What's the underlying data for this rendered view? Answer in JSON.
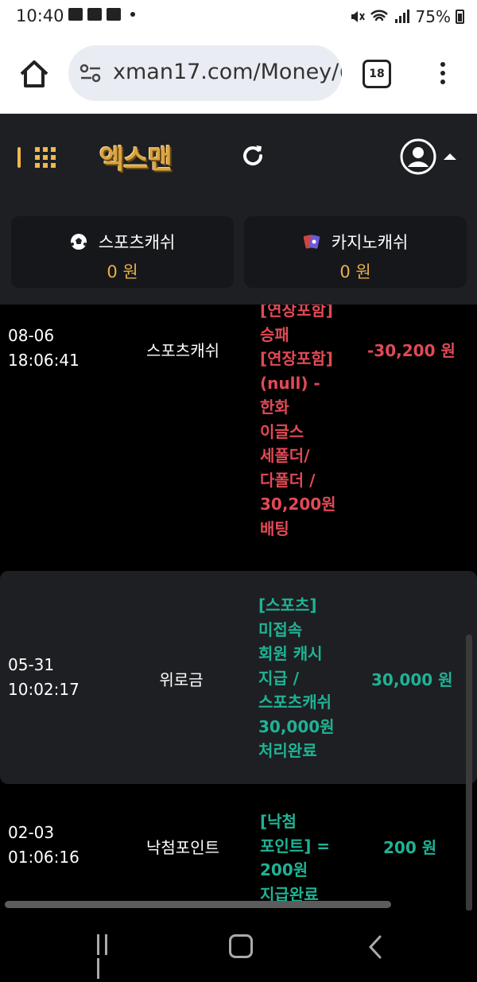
{
  "status_bar": {
    "time": "10:40",
    "battery": "75%"
  },
  "browser": {
    "url": "xman17.com/Money/(",
    "tab_count": "18"
  },
  "site": {
    "logo": "엑스맨",
    "sports_cash": {
      "label": "스포츠캐쉬",
      "amount": "0 원"
    },
    "casino_cash": {
      "label": "카지노캐쉬",
      "amount": "0 원"
    }
  },
  "rows": [
    {
      "date": "08-06",
      "time": "18:06:41",
      "type": "스포츠캐쉬",
      "desc": [
        "[연장포함]",
        "승패",
        "[연장포함]",
        "(null) -",
        "한화",
        "이글스",
        "세폴더/",
        "다폴더 /",
        "30,200원",
        "배팅"
      ],
      "amount": "-30,200 원"
    },
    {
      "date": "05-31",
      "time": "10:02:17",
      "type": "위로금",
      "desc": [
        "[스포츠]",
        "미접속",
        "회원 캐시",
        "지급 /",
        "스포츠캐쉬",
        "30,000원",
        "처리완료"
      ],
      "amount": "30,000 원"
    },
    {
      "date": "02-03",
      "time": "01:06:16",
      "type": "낙첨포인트",
      "desc": [
        "[낙첨",
        "포인트] =",
        "200원",
        "지급완료"
      ],
      "amount": "200 원"
    }
  ],
  "colors": {
    "negative": "#e04a55",
    "positive": "#1fb394",
    "accent": "#e8b04a",
    "header_bg": "#1e1f23"
  }
}
